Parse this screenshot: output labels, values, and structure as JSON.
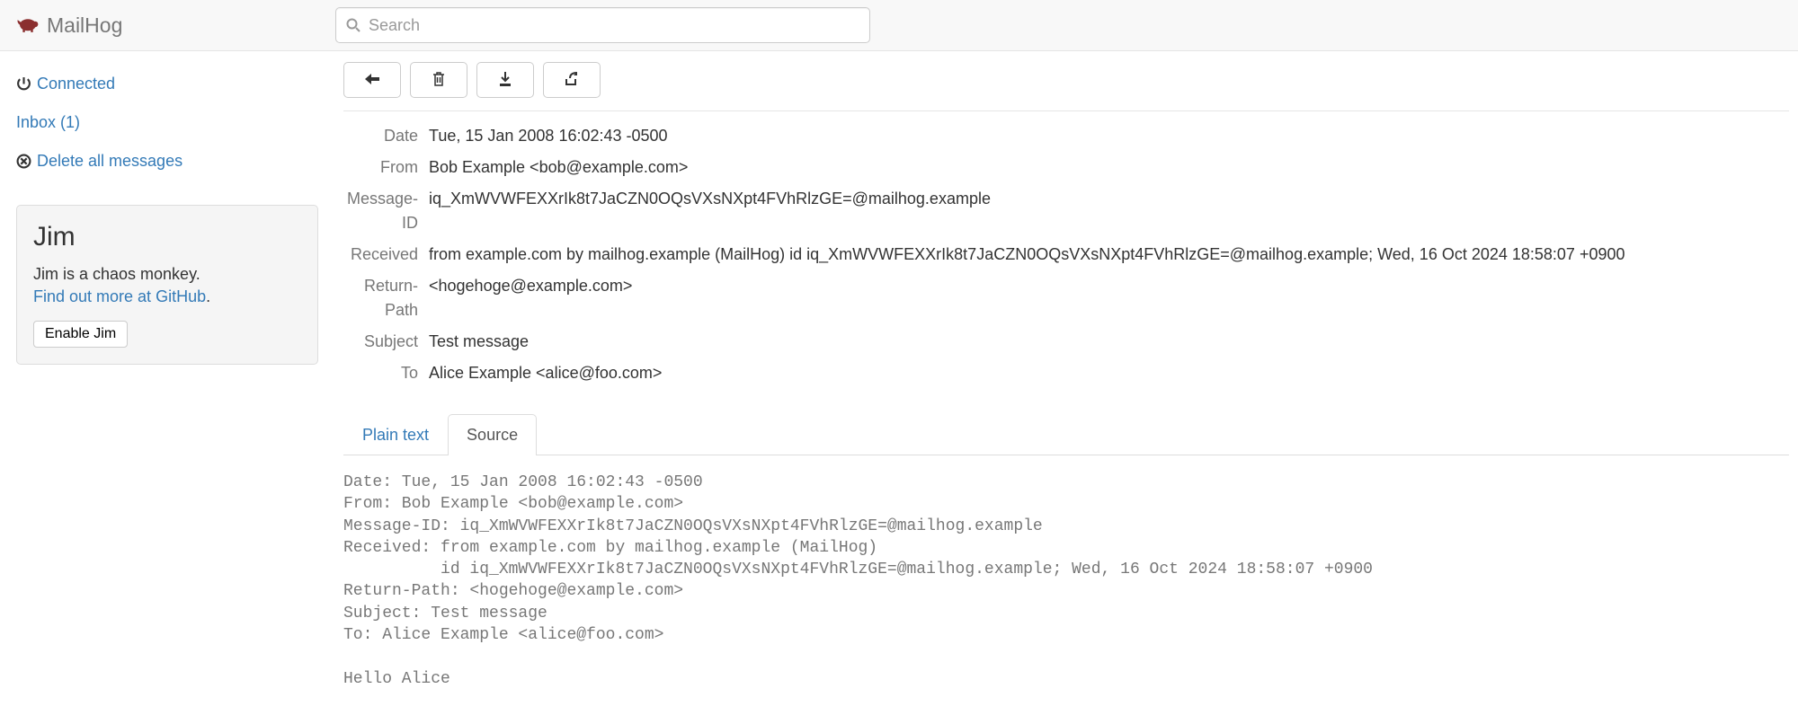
{
  "brand": {
    "name": "MailHog"
  },
  "search": {
    "placeholder": "Search"
  },
  "sidebar": {
    "connected": "Connected",
    "inbox": "Inbox (1)",
    "delete_all": "Delete all messages",
    "jim": {
      "title": "Jim",
      "desc": "Jim is a chaos monkey.",
      "link_text": "Find out more at GitHub",
      "button": "Enable Jim"
    }
  },
  "toolbar": {
    "back": "back",
    "delete": "delete",
    "download": "download",
    "release": "release"
  },
  "headers": {
    "labels": {
      "date": "Date",
      "from": "From",
      "message_id": "Message-ID",
      "received": "Received",
      "return_path": "Return-Path",
      "subject": "Subject",
      "to": "To"
    },
    "values": {
      "date": "Tue, 15 Jan 2008 16:02:43 -0500",
      "from": "Bob Example <bob@example.com>",
      "message_id": "iq_XmWVWFEXXrIk8t7JaCZN0OQsVXsNXpt4FVhRlzGE=@mailhog.example",
      "received": "from example.com by mailhog.example (MailHog) id iq_XmWVWFEXXrIk8t7JaCZN0OQsVXsNXpt4FVhRlzGE=@mailhog.example; Wed, 16 Oct 2024 18:58:07 +0900",
      "return_path": "<hogehoge@example.com>",
      "subject": "Test message",
      "to": "Alice Example <alice@foo.com>"
    }
  },
  "tabs": {
    "plain": "Plain text",
    "source": "Source"
  },
  "source_text": "Date: Tue, 15 Jan 2008 16:02:43 -0500\nFrom: Bob Example <bob@example.com>\nMessage-ID: iq_XmWVWFEXXrIk8t7JaCZN0OQsVXsNXpt4FVhRlzGE=@mailhog.example\nReceived: from example.com by mailhog.example (MailHog)\n          id iq_XmWVWFEXXrIk8t7JaCZN0OQsVXsNXpt4FVhRlzGE=@mailhog.example; Wed, 16 Oct 2024 18:58:07 +0900\nReturn-Path: <hogehoge@example.com>\nSubject: Test message\nTo: Alice Example <alice@foo.com>\n\nHello Alice"
}
